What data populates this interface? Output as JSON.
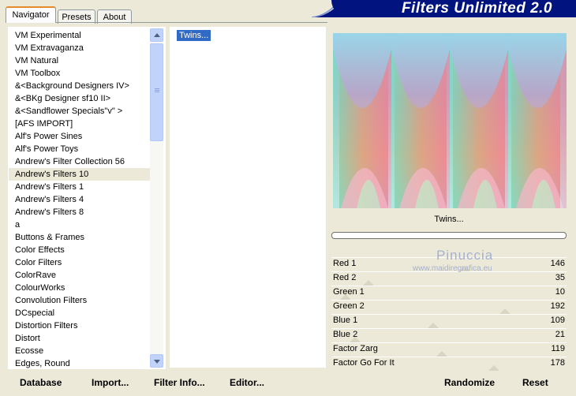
{
  "tabs": [
    {
      "label": "Navigator"
    },
    {
      "label": "Presets"
    },
    {
      "label": "About"
    }
  ],
  "banner_title": "Filters Unlimited 2.0",
  "categories": [
    "VM Experimental",
    "VM Extravaganza",
    "VM Natural",
    "VM Toolbox",
    "&<Background Designers IV>",
    "&<BKg Designer sf10 II>",
    "&<Sandflower Specials\"v\" >",
    "[AFS IMPORT]",
    "Alf's Power Sines",
    "Alf's Power Toys",
    "Andrew's Filter Collection 56",
    "Andrew's Filters 10",
    "Andrew's Filters 1",
    "Andrew's Filters 4",
    "Andrew's Filters 8",
    "a",
    "Buttons & Frames",
    "Color Effects",
    "Color Filters",
    "ColorRave",
    "ColourWorks",
    "Convolution Filters",
    "DCspecial",
    "Distortion Filters",
    "Distort",
    "Ecosse",
    "Edges, Round"
  ],
  "selected_category": "Andrew's Filters 10",
  "filters": [
    "Twins..."
  ],
  "current_filter": "Twins...",
  "sliders": [
    {
      "label": "Red 1",
      "value": "146",
      "thumb_fraction": 0.57
    },
    {
      "label": "Red 2",
      "value": "35",
      "thumb_fraction": 0.14
    },
    {
      "label": "Green 1",
      "value": "10",
      "thumb_fraction": 0.04
    },
    {
      "label": "Green 2",
      "value": "192",
      "thumb_fraction": 0.75
    },
    {
      "label": "Blue 1",
      "value": "109",
      "thumb_fraction": 0.43
    },
    {
      "label": "Blue 2",
      "value": "21",
      "thumb_fraction": 0.08
    },
    {
      "label": "Factor Zarg",
      "value": "119",
      "thumb_fraction": 0.47
    },
    {
      "label": "Factor Go For It",
      "value": "178",
      "thumb_fraction": 0.7
    }
  ],
  "watermark": {
    "name": "Pinuccia",
    "url": "www.maidiregrafica.eu"
  },
  "buttons": {
    "database": "Database",
    "import": "Import...",
    "filter_info": "Filter Info...",
    "editor": "Editor...",
    "randomize": "Randomize",
    "reset": "Reset"
  },
  "colors": {
    "banner": "#00137f",
    "selection": "#316ac5",
    "active_tab": "#e68b2c"
  }
}
